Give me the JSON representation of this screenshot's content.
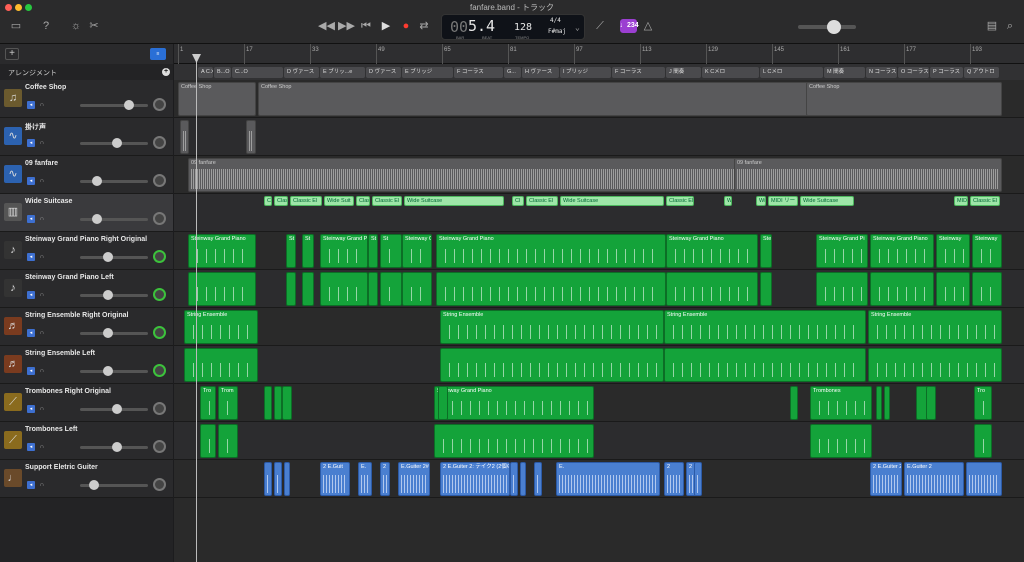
{
  "window": {
    "title": "fanfare.band - トラック"
  },
  "transport": {
    "position": "5.4",
    "position_sub": "00",
    "bar_label": "BAR",
    "beat_label": "BEAT",
    "tempo": "128",
    "tempo_label": "TEMPO",
    "time_sig": "4/4",
    "key": "F#maj",
    "cycle_badge": "♩234",
    "volume_fraction": 0.52
  },
  "sidebar": {
    "arrange_label": "アレンジメント"
  },
  "tracks": [
    {
      "name": "Coffee Shop",
      "icon": "arrangement-icon",
      "pan_green": false,
      "volume_fraction": 0.75
    },
    {
      "name": "掛け声",
      "icon": "waveform-icon",
      "pan_green": false,
      "volume_fraction": 0.55
    },
    {
      "name": "09 fanfare",
      "icon": "waveform-icon",
      "pan_green": false,
      "volume_fraction": 0.2
    },
    {
      "name": "Wide Suitcase",
      "icon": "keyboard-icon",
      "pan_green": false,
      "volume_fraction": 0.2
    },
    {
      "name": "Steinway Grand Piano Right Original",
      "icon": "piano-icon",
      "pan_green": true,
      "volume_fraction": 0.4
    },
    {
      "name": "Steinway Grand Piano Left",
      "icon": "piano-icon",
      "pan_green": true,
      "volume_fraction": 0.4
    },
    {
      "name": "String Ensemble Right Original",
      "icon": "violin-icon",
      "pan_green": true,
      "volume_fraction": 0.4
    },
    {
      "name": "String Ensemble Left",
      "icon": "violin-icon",
      "pan_green": true,
      "volume_fraction": 0.4
    },
    {
      "name": "Trombones Right Original",
      "icon": "trombone-icon",
      "pan_green": false,
      "volume_fraction": 0.55
    },
    {
      "name": "Trombones Left",
      "icon": "trombone-icon",
      "pan_green": false,
      "volume_fraction": 0.55
    },
    {
      "name": "Support Eletric Guiter",
      "icon": "guitar-icon",
      "pan_green": false,
      "volume_fraction": 0.15
    }
  ],
  "ruler": {
    "bars": [
      "1",
      "17",
      "33",
      "49",
      "65",
      "81",
      "97",
      "113",
      "129",
      "145",
      "161",
      "177",
      "193"
    ]
  },
  "sections": [
    "A Cメロ",
    "B...O",
    "C...O",
    "D ヴァース",
    "E ブリッ...e",
    "D ヴァース",
    "E ブリッジ",
    "F コーラス",
    "G...",
    "H ヴァース",
    "I ブリッジ",
    "F コーラス",
    "J 間奏",
    "K Cメロ",
    "L Cメロ",
    "M 間奏",
    "N コーラス",
    "O コーラス",
    "P コーラス",
    "Q アウトロ"
  ],
  "regions": {
    "coffee": [
      "Coffee Shop",
      "Coffee Shop",
      "Coffee Shop"
    ],
    "fanfare": [
      "09 fanfare",
      "09 fanfare"
    ],
    "wide": [
      "Cl",
      "Clas",
      "Classic El",
      "Wide Suit",
      "Classic El",
      "Classic El",
      "Wide Suitcase",
      "Cl",
      "Classic El",
      "Wide Suitcase",
      "Classic El",
      "Wi",
      "Wide",
      "MIDI リー",
      "Wide Suitcase",
      "MIDI",
      "Classic El"
    ],
    "piano": [
      "Steinway Grand Piano",
      "St",
      "St",
      "Steinway Grand Piano",
      "St",
      "St",
      "Steinway Grand Piano",
      "Steinway Grand Piano",
      "Steinway Grand Piano",
      "Stei",
      "Steinway Grand Pi",
      "Steinway Grand Piano",
      "Steinway",
      "Steinway"
    ],
    "strings": [
      "String Ensemble",
      "String Ensemble",
      "String Ensemble",
      "String Ensemble"
    ],
    "trombones": [
      "Tro",
      "Trom",
      "Steinway Grand Piano",
      "Trombones",
      "Tro"
    ],
    "guitar": [
      "2 E.Guit",
      "E.",
      "2",
      "E.Guiter 2#11.1",
      "2 E.Guiter 2: テイク2 (2個のテイク",
      "E.",
      "2",
      "2 E.Guite",
      "2 E.Guiter 2: テイ",
      "E.Guiter 2"
    ]
  }
}
